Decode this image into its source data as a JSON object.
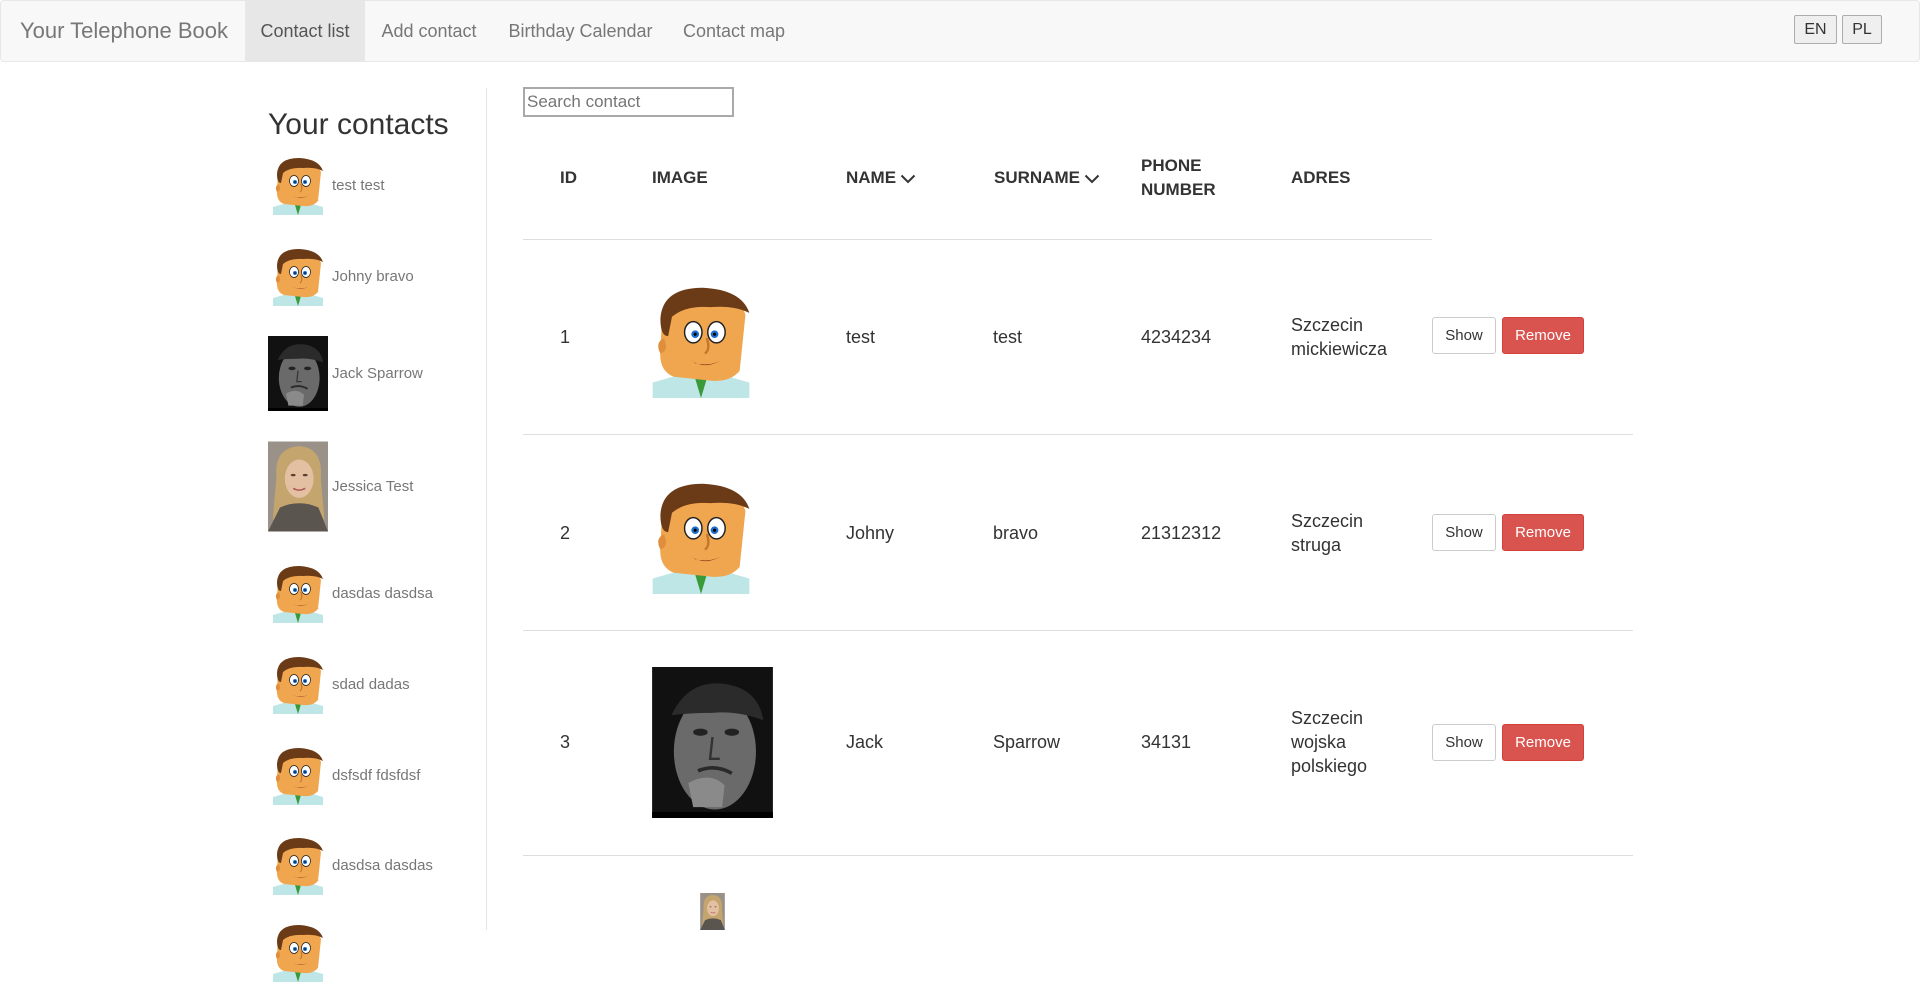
{
  "navbar": {
    "brand": "Your Telephone Book",
    "items": [
      {
        "label": "Contact list",
        "active": true
      },
      {
        "label": "Add contact",
        "active": false
      },
      {
        "label": "Birthday Calendar",
        "active": false
      },
      {
        "label": "Contact map",
        "active": false
      }
    ],
    "languages": [
      "EN",
      "PL"
    ]
  },
  "sidebar": {
    "title": "Your contacts",
    "contacts": [
      {
        "name": "test test",
        "image": "cartoon-man"
      },
      {
        "name": "Johny bravo",
        "image": "cartoon-man"
      },
      {
        "name": "Jack Sparrow",
        "image": "bw-photo-man"
      },
      {
        "name": "Jessica Test",
        "image": "photo-woman"
      },
      {
        "name": "dasdas dasdsa",
        "image": "cartoon-man"
      },
      {
        "name": "sdad dadas",
        "image": "cartoon-man"
      },
      {
        "name": "dsfsdf fdsfdsf",
        "image": "cartoon-man"
      },
      {
        "name": "dasdsa dasdas",
        "image": "cartoon-man"
      }
    ]
  },
  "search": {
    "placeholder": "Search contact",
    "value": ""
  },
  "table": {
    "headers": {
      "id": "ID",
      "image": "IMAGE",
      "name": "NAME",
      "surname": "SURNAME",
      "phone_line1": "PHONE",
      "phone_line2": "NUMBER",
      "address": "ADRES"
    },
    "rows": [
      {
        "id": "1",
        "image": "cartoon-man",
        "name": "test",
        "surname": "test",
        "phone": "4234234",
        "address": [
          "Szczecin",
          "mickiewicza"
        ]
      },
      {
        "id": "2",
        "image": "cartoon-man",
        "name": "Johny",
        "surname": "bravo",
        "phone": "21312312",
        "address": [
          "Szczecin",
          "struga"
        ]
      },
      {
        "id": "3",
        "image": "bw-photo-man",
        "name": "Jack",
        "surname": "Sparrow",
        "phone": "34131",
        "address": [
          "Szczecin",
          "wojska",
          "polskiego"
        ]
      },
      {
        "image": "photo-woman"
      }
    ],
    "show_label": "Show",
    "remove_label": "Remove"
  },
  "colors": {
    "navbar_bg": "#f8f8f8",
    "active_nav_bg": "#e7e7e7",
    "remove_button": "#d9534f",
    "link_gray": "#777777"
  }
}
